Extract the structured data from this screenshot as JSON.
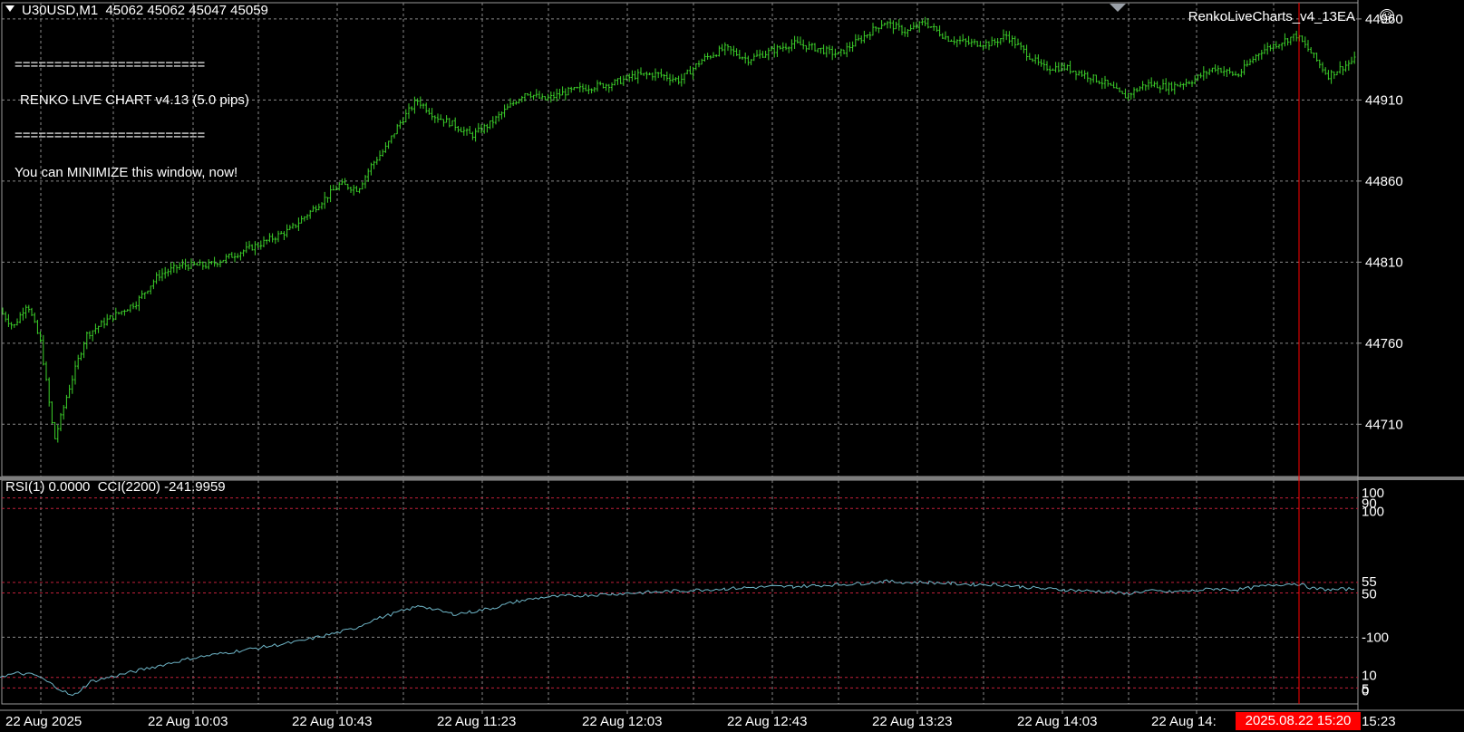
{
  "header": {
    "symbol": "U30USD,M1",
    "ohlc": "45062 45062 45047 45059",
    "ea_name": "RenkoLiveCharts_v4_13EA",
    "ea_icon": "frown-face-icon"
  },
  "renko_box": {
    "sep_top": "========================",
    "title": "RENKO LIVE CHART v4.13 (5.0 pips)",
    "sep_bottom": "========================",
    "message": "You can MINIMIZE this window, now!"
  },
  "indicator": {
    "label": "RSI(1) 0.0000  CCI(2200) -241.9959"
  },
  "time_badge": "2025.08.22 15:20",
  "colors": {
    "background": "#000000",
    "bars": "#3cd22a",
    "grid": "#8a8a8a",
    "indicator_line": "#6fb6c8",
    "level_lines": "#c0203a",
    "crosshair": "#ff0000",
    "axis_text": "#ffffff"
  },
  "chart_data": [
    {
      "type": "ohlc",
      "symbol": "U30USD",
      "timeframe": "M1",
      "ylim": [
        44680,
        44970
      ],
      "y_ticks": [
        44960,
        44910,
        44860,
        44810,
        44760,
        44710
      ],
      "x_ticks": [
        "22 Aug 2025",
        "22 Aug 10:03",
        "22 Aug 10:43",
        "22 Aug 11:23",
        "22 Aug 12:03",
        "22 Aug 12:43",
        "22 Aug 13:23",
        "22 Aug 14:03",
        "22 Aug 14:",
        "15:23"
      ],
      "close_path": [
        [
          0,
          44780
        ],
        [
          15,
          44770
        ],
        [
          30,
          44785
        ],
        [
          45,
          44760
        ],
        [
          60,
          44700
        ],
        [
          75,
          44730
        ],
        [
          95,
          44765
        ],
        [
          120,
          44775
        ],
        [
          150,
          44785
        ],
        [
          175,
          44802
        ],
        [
          200,
          44808
        ],
        [
          230,
          44808
        ],
        [
          260,
          44815
        ],
        [
          290,
          44822
        ],
        [
          320,
          44830
        ],
        [
          350,
          44845
        ],
        [
          375,
          44858
        ],
        [
          395,
          44855
        ],
        [
          410,
          44870
        ],
        [
          425,
          44880
        ],
        [
          440,
          44895
        ],
        [
          460,
          44910
        ],
        [
          480,
          44900
        ],
        [
          500,
          44895
        ],
        [
          520,
          44888
        ],
        [
          540,
          44895
        ],
        [
          560,
          44905
        ],
        [
          580,
          44915
        ],
        [
          600,
          44910
        ],
        [
          625,
          44915
        ],
        [
          650,
          44918
        ],
        [
          675,
          44920
        ],
        [
          700,
          44925
        ],
        [
          725,
          44926
        ],
        [
          750,
          44922
        ],
        [
          775,
          44935
        ],
        [
          800,
          44942
        ],
        [
          825,
          44935
        ],
        [
          850,
          44940
        ],
        [
          875,
          44945
        ],
        [
          900,
          44942
        ],
        [
          925,
          44938
        ],
        [
          950,
          44948
        ],
        [
          975,
          44958
        ],
        [
          1000,
          44952
        ],
        [
          1020,
          44958
        ],
        [
          1045,
          44948
        ],
        [
          1070,
          44945
        ],
        [
          1095,
          44945
        ],
        [
          1110,
          44950
        ],
        [
          1130,
          44940
        ],
        [
          1150,
          44930
        ],
        [
          1175,
          44930
        ],
        [
          1200,
          44925
        ],
        [
          1220,
          44920
        ],
        [
          1240,
          44912
        ],
        [
          1265,
          44920
        ],
        [
          1290,
          44918
        ],
        [
          1315,
          44922
        ],
        [
          1340,
          44930
        ],
        [
          1365,
          44925
        ],
        [
          1390,
          44940
        ],
        [
          1410,
          44945
        ],
        [
          1430,
          44950
        ],
        [
          1445,
          44940
        ],
        [
          1465,
          44925
        ],
        [
          1480,
          44930
        ],
        [
          1495,
          44935
        ]
      ]
    },
    {
      "type": "line",
      "indicators": [
        "RSI(1)",
        "CCI(2200)"
      ],
      "rsi_value": 0.0,
      "cci_value": -241.9959,
      "y_ticks": [
        "100",
        "90",
        "100",
        "55",
        "50",
        "-100",
        "10",
        "5",
        "0"
      ],
      "levels": [
        95,
        90,
        55,
        50,
        10,
        5
      ],
      "series": [
        {
          "name": "CCI(2200)",
          "path": [
            [
              0,
              10.5
            ],
            [
              20,
              12
            ],
            [
              40,
              11
            ],
            [
              60,
              6
            ],
            [
              80,
              1
            ],
            [
              100,
              8
            ],
            [
              120,
              10
            ],
            [
              150,
              13
            ],
            [
              180,
              16
            ],
            [
              210,
              19
            ],
            [
              240,
              21
            ],
            [
              270,
              23
            ],
            [
              300,
              25
            ],
            [
              330,
              27
            ],
            [
              360,
              30
            ],
            [
              390,
              33
            ],
            [
              410,
              37
            ],
            [
              440,
              41
            ],
            [
              465,
              44
            ],
            [
              480,
              42
            ],
            [
              500,
              40
            ],
            [
              520,
              41
            ],
            [
              545,
              43
            ],
            [
              570,
              46
            ],
            [
              600,
              48
            ],
            [
              625,
              48.5
            ],
            [
              650,
              49
            ],
            [
              675,
              49.5
            ],
            [
              700,
              50
            ],
            [
              725,
              50.5
            ],
            [
              750,
              51
            ],
            [
              775,
              51.5
            ],
            [
              800,
              52
            ],
            [
              825,
              52.5
            ],
            [
              850,
              53
            ],
            [
              875,
              53
            ],
            [
              900,
              53.5
            ],
            [
              925,
              54
            ],
            [
              950,
              54.5
            ],
            [
              975,
              55.5
            ],
            [
              1000,
              55
            ],
            [
              1025,
              55
            ],
            [
              1050,
              54.5
            ],
            [
              1075,
              54
            ],
            [
              1100,
              54
            ],
            [
              1125,
              53
            ],
            [
              1150,
              52
            ],
            [
              1175,
              51.5
            ],
            [
              1200,
              51
            ],
            [
              1225,
              50.5
            ],
            [
              1240,
              49.5
            ],
            [
              1265,
              51
            ],
            [
              1290,
              50.5
            ],
            [
              1315,
              51
            ],
            [
              1340,
              52
            ],
            [
              1365,
              51.5
            ],
            [
              1390,
              53
            ],
            [
              1410,
              54
            ],
            [
              1430,
              54.5
            ],
            [
              1450,
              52
            ],
            [
              1470,
              51.5
            ],
            [
              1495,
              52
            ]
          ]
        }
      ]
    }
  ]
}
